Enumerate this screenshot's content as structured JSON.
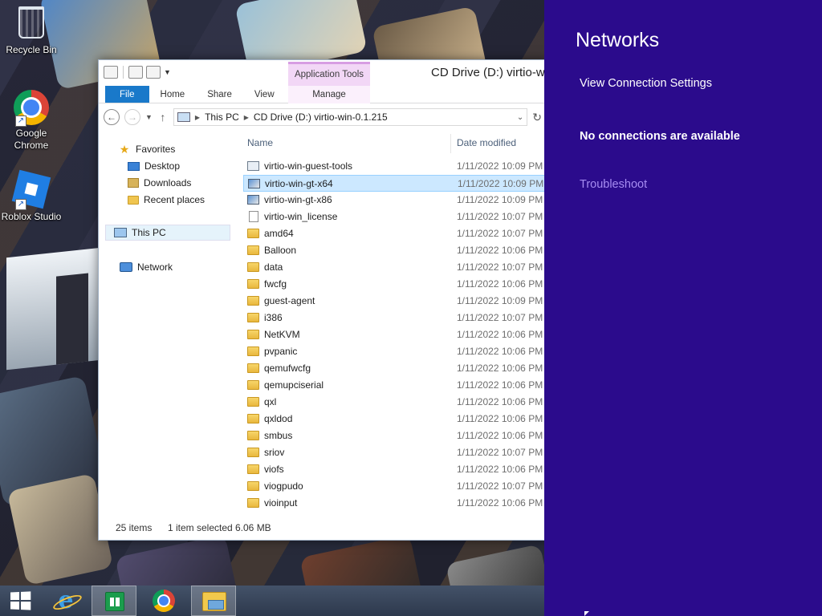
{
  "desktop": {
    "icons": [
      {
        "label": "Recycle Bin",
        "icon": "recycle-bin-icon"
      },
      {
        "label": "Google Chrome",
        "icon": "chrome-icon"
      },
      {
        "label": "Roblox Studio",
        "icon": "roblox-studio-icon"
      }
    ]
  },
  "explorer": {
    "title": "CD Drive (D:) virtio-w",
    "context_tab_group": "Application Tools",
    "tabs": [
      "File",
      "Home",
      "Share",
      "View",
      "Manage"
    ],
    "address": {
      "crumbs": [
        "This PC",
        "CD Drive (D:) virtio-win-0.1.215"
      ]
    },
    "nav": {
      "favorites": "Favorites",
      "desktop": "Desktop",
      "downloads": "Downloads",
      "recent": "Recent places",
      "this_pc": "This PC",
      "network": "Network"
    },
    "columns": {
      "name": "Name",
      "date": "Date modified"
    },
    "files": [
      {
        "name": "virtio-win-guest-tools",
        "date": "1/11/2022 10:09 PM",
        "type": "exe"
      },
      {
        "name": "virtio-win-gt-x64",
        "date": "1/11/2022 10:09 PM",
        "type": "msi",
        "selected": true
      },
      {
        "name": "virtio-win-gt-x86",
        "date": "1/11/2022 10:09 PM",
        "type": "msi"
      },
      {
        "name": "virtio-win_license",
        "date": "1/11/2022 10:07 PM",
        "type": "doc"
      },
      {
        "name": "amd64",
        "date": "1/11/2022 10:07 PM",
        "type": "folder"
      },
      {
        "name": "Balloon",
        "date": "1/11/2022 10:06 PM",
        "type": "folder"
      },
      {
        "name": "data",
        "date": "1/11/2022 10:07 PM",
        "type": "folder"
      },
      {
        "name": "fwcfg",
        "date": "1/11/2022 10:06 PM",
        "type": "folder"
      },
      {
        "name": "guest-agent",
        "date": "1/11/2022 10:09 PM",
        "type": "folder"
      },
      {
        "name": "i386",
        "date": "1/11/2022 10:07 PM",
        "type": "folder"
      },
      {
        "name": "NetKVM",
        "date": "1/11/2022 10:06 PM",
        "type": "folder"
      },
      {
        "name": "pvpanic",
        "date": "1/11/2022 10:06 PM",
        "type": "folder"
      },
      {
        "name": "qemufwcfg",
        "date": "1/11/2022 10:06 PM",
        "type": "folder"
      },
      {
        "name": "qemupciserial",
        "date": "1/11/2022 10:06 PM",
        "type": "folder"
      },
      {
        "name": "qxl",
        "date": "1/11/2022 10:06 PM",
        "type": "folder"
      },
      {
        "name": "qxldod",
        "date": "1/11/2022 10:06 PM",
        "type": "folder"
      },
      {
        "name": "smbus",
        "date": "1/11/2022 10:06 PM",
        "type": "folder"
      },
      {
        "name": "sriov",
        "date": "1/11/2022 10:07 PM",
        "type": "folder"
      },
      {
        "name": "viofs",
        "date": "1/11/2022 10:06 PM",
        "type": "folder"
      },
      {
        "name": "viogpudo",
        "date": "1/11/2022 10:07 PM",
        "type": "folder"
      },
      {
        "name": "vioinput",
        "date": "1/11/2022 10:06 PM",
        "type": "folder"
      }
    ],
    "status": {
      "count": "25 items",
      "selected": "1 item selected",
      "size": "6.06 MB"
    }
  },
  "charm": {
    "title": "Networks",
    "settings_link": "View Connection Settings",
    "message": "No connections are available",
    "troubleshoot": "Troubleshoot",
    "background": "#2b0b8c",
    "link_color": "#a68cf2"
  },
  "taskbar": {
    "items": [
      "start-icon",
      "internet-explorer-icon",
      "store-icon",
      "chrome-icon",
      "file-explorer-icon"
    ]
  }
}
